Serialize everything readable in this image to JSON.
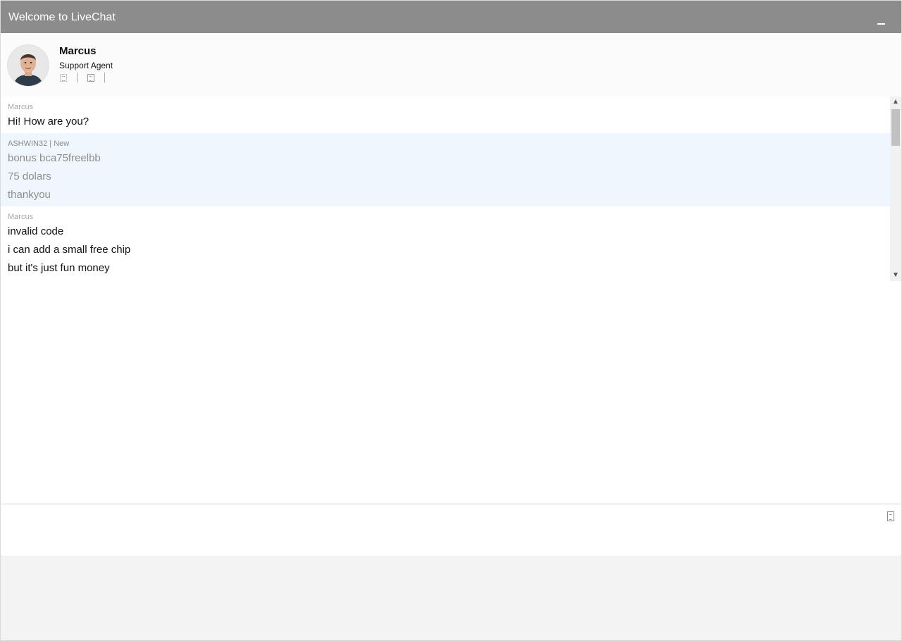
{
  "window": {
    "title": "Welcome to LiveChat",
    "minimize_icon": "minimize-icon"
  },
  "agent": {
    "name": "Marcus",
    "role": "Support Agent",
    "avatar": "agent-avatar-photo",
    "action_icons": [
      "rate-good-icon",
      "rate-bad-icon"
    ]
  },
  "messages": [
    {
      "author": "Marcus",
      "role": "agent",
      "lines": [
        "Hi! How are you?"
      ]
    },
    {
      "author": "ASHWIN32 | New",
      "role": "visitor",
      "lines": [
        "bonus bca75freelbb",
        "75 dolars",
        "thankyou"
      ]
    },
    {
      "author": "Marcus",
      "role": "agent",
      "lines": [
        "invalid code",
        "i can add a small free chip",
        "but it's just fun money"
      ]
    }
  ],
  "scrollbar": {
    "up_icon": "scroll-up-icon",
    "down_icon": "scroll-down-icon",
    "position": 0.1
  },
  "composer": {
    "value": "",
    "placeholder": "",
    "attach_icon": "attachment-icon"
  },
  "colors": {
    "titlebar": "#8c8c8c",
    "visitor_bubble": "#eff6fd",
    "page_background": "#f3f3f3"
  }
}
